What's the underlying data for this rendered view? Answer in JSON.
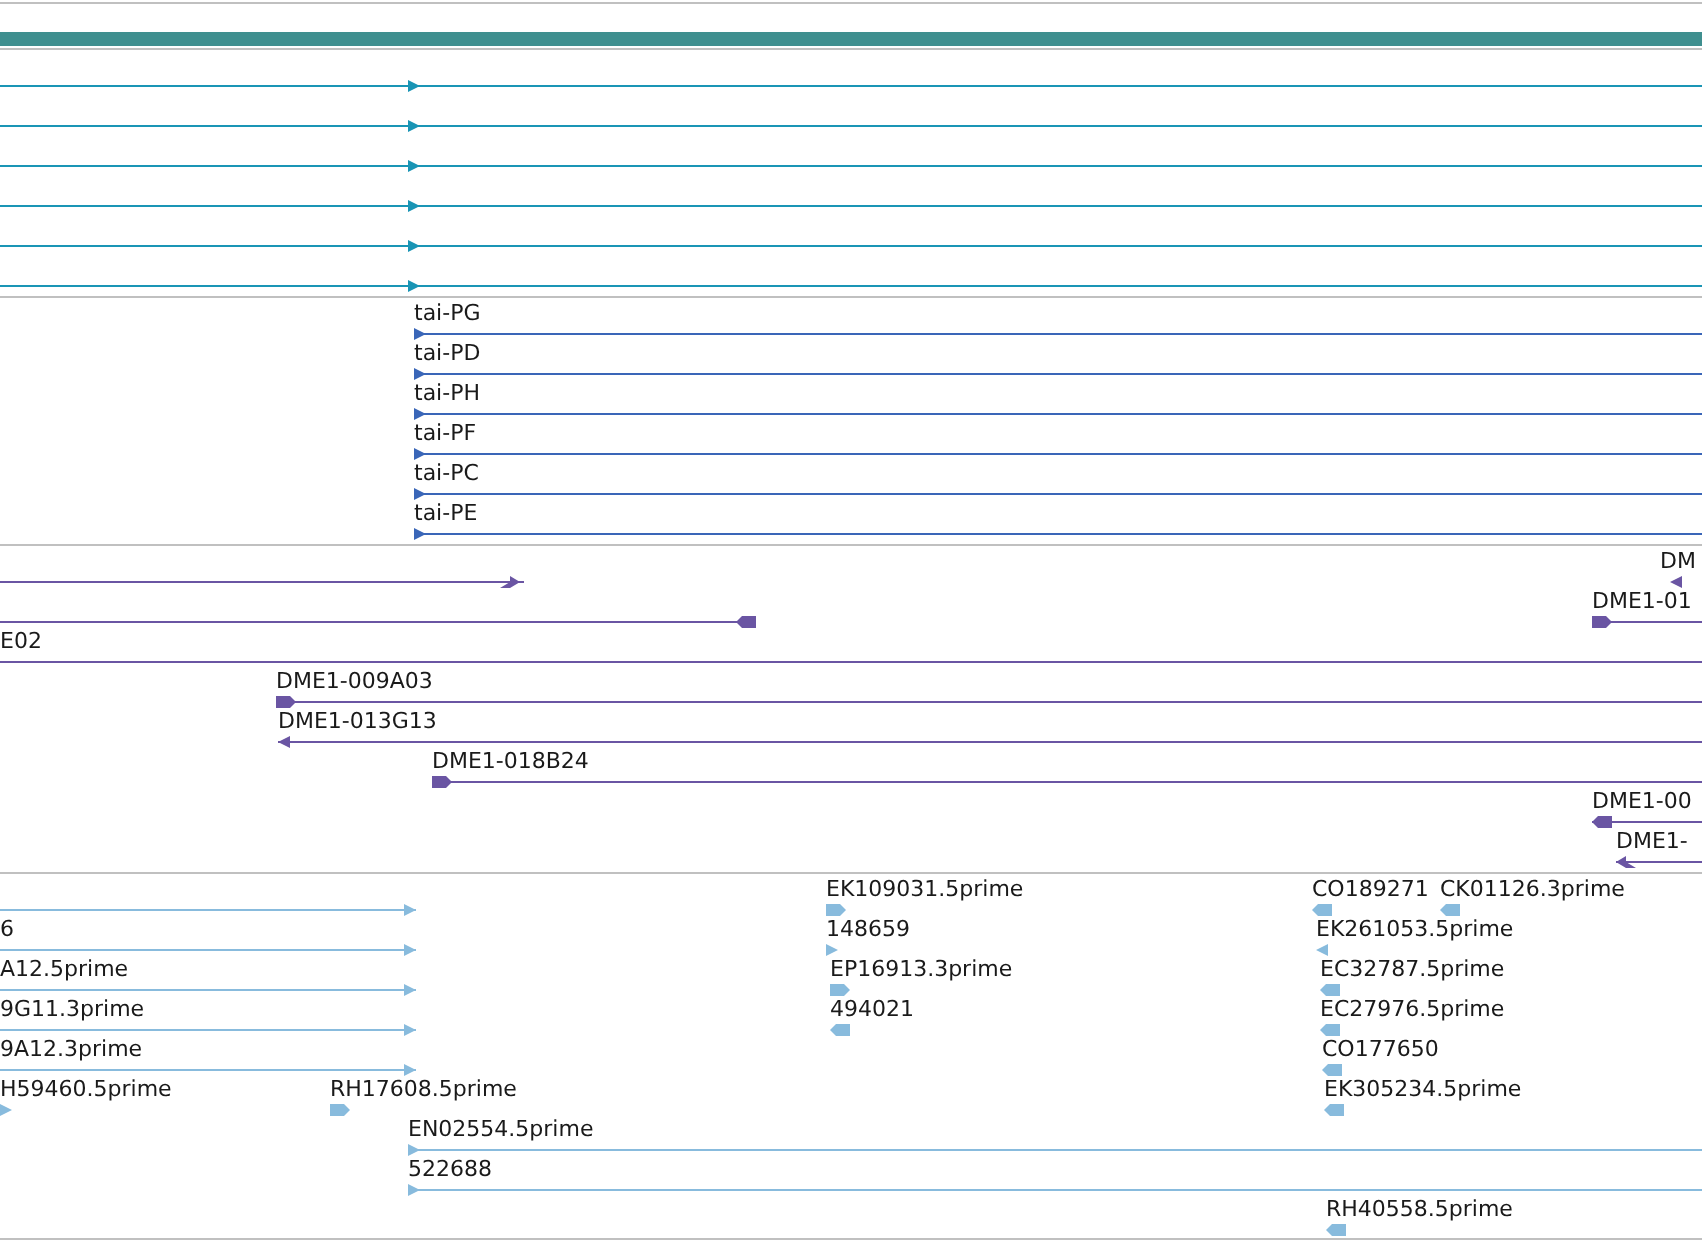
{
  "tracks": [
    {
      "kind": "gene",
      "features": [
        {
          "reverse": false
        },
        {
          "reverse": false
        },
        {
          "reverse": false
        },
        {
          "reverse": false
        },
        {
          "reverse": false
        },
        {
          "reverse": false
        }
      ]
    },
    {
      "kind": "transcript",
      "features": [
        {
          "label": "tai-PG",
          "reverse": false
        },
        {
          "label": "tai-PD",
          "reverse": false
        },
        {
          "label": "tai-PH",
          "reverse": false
        },
        {
          "label": "tai-PF",
          "reverse": false
        },
        {
          "label": "tai-PC",
          "reverse": false
        },
        {
          "label": "tai-PE",
          "reverse": false
        }
      ]
    },
    {
      "kind": "clone",
      "features": [
        {
          "reverse": false
        },
        {
          "label": "DM",
          "reverse": true
        },
        {
          "reverse": true
        },
        {
          "label": "DME1-01",
          "reverse": false
        },
        {
          "label": "E02"
        },
        {
          "label": "DME1-009A03",
          "reverse": false
        },
        {
          "label": "DME1-013G13",
          "reverse": true
        },
        {
          "label": "DME1-018B24",
          "reverse": false
        },
        {
          "label": "DME1-00",
          "reverse": true
        },
        {
          "label": "DME1-",
          "reverse": true
        }
      ]
    },
    {
      "kind": "est",
      "features": [
        {
          "reverse": false
        },
        {
          "label": "6",
          "reverse": false
        },
        {
          "label": "A12.5prime",
          "reverse": false
        },
        {
          "label": "9G11.3prime",
          "reverse": false
        },
        {
          "label": "9A12.3prime",
          "reverse": false
        },
        {
          "label": "H59460.5prime",
          "reverse": false
        },
        {
          "label": "RH17608.5prime",
          "reverse": false
        },
        {
          "label": "EN02554.5prime",
          "reverse": false
        },
        {
          "label": "522688",
          "reverse": false
        },
        {
          "label": "EK109031.5prime",
          "reverse": false
        },
        {
          "label": "148659",
          "reverse": false
        },
        {
          "label": "EP16913.3prime",
          "reverse": false
        },
        {
          "label": "494021",
          "reverse": true
        },
        {
          "label": "CO189271",
          "reverse": true
        },
        {
          "label": "CK01126.3prime",
          "reverse": true
        },
        {
          "label": "EK261053.5prime",
          "reverse": true
        },
        {
          "label": "EC32787.5prime",
          "reverse": true
        },
        {
          "label": "EC27976.5prime",
          "reverse": true
        },
        {
          "label": "CO177650",
          "reverse": true
        },
        {
          "label": "EK305234.5prime",
          "reverse": true
        },
        {
          "label": "RH40558.5prime",
          "reverse": true
        }
      ]
    }
  ]
}
